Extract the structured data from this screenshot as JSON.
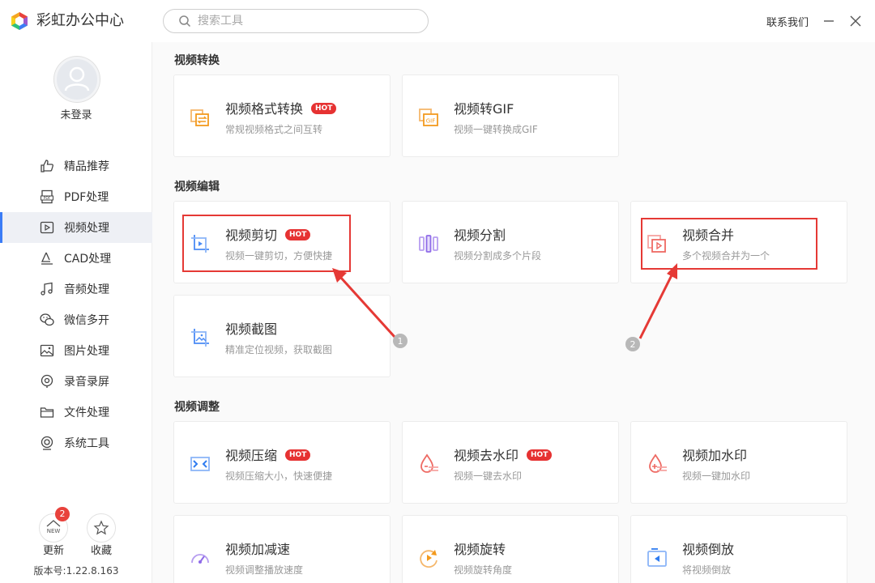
{
  "app": {
    "title": "彩虹办公中心"
  },
  "search": {
    "placeholder": "搜索工具"
  },
  "header": {
    "contact_label": "联系我们"
  },
  "user": {
    "login_status": "未登录"
  },
  "sidebar": {
    "items": [
      {
        "label": "精品推荐",
        "icon": "thumbs-up-icon"
      },
      {
        "label": "PDF处理",
        "icon": "pdf-icon"
      },
      {
        "label": "视频处理",
        "icon": "video-icon",
        "active": true
      },
      {
        "label": "CAD处理",
        "icon": "cad-icon"
      },
      {
        "label": "音频处理",
        "icon": "music-icon"
      },
      {
        "label": "微信多开",
        "icon": "wechat-icon"
      },
      {
        "label": "图片处理",
        "icon": "image-icon"
      },
      {
        "label": "录音录屏",
        "icon": "record-icon"
      },
      {
        "label": "文件处理",
        "icon": "folder-icon"
      },
      {
        "label": "系统工具",
        "icon": "system-tools-icon"
      }
    ],
    "update": {
      "label": "更新",
      "badge": "2",
      "icon_text": "NEW"
    },
    "favorite": {
      "label": "收藏"
    },
    "version": "版本号:1.22.8.163"
  },
  "sections": {
    "convert": {
      "title": "视频转换",
      "cards": [
        {
          "title": "视频格式转换",
          "desc": "常规视频格式之间互转",
          "hot": true,
          "icon": "format-convert-icon"
        },
        {
          "title": "视频转GIF",
          "desc": "视频一键转换成GIF",
          "hot": false,
          "icon": "gif-icon"
        }
      ]
    },
    "edit": {
      "title": "视频编辑",
      "cards": [
        {
          "title": "视频剪切",
          "desc": "视频一键剪切，方便快捷",
          "hot": true,
          "icon": "crop-video-icon"
        },
        {
          "title": "视频分割",
          "desc": "视频分割成多个片段",
          "hot": false,
          "icon": "split-icon"
        },
        {
          "title": "视频合并",
          "desc": "多个视频合并为一个",
          "hot": false,
          "icon": "merge-icon"
        },
        {
          "title": "视频截图",
          "desc": "精准定位视频，获取截图",
          "hot": false,
          "icon": "screenshot-icon"
        }
      ]
    },
    "adjust": {
      "title": "视频调整",
      "cards": [
        {
          "title": "视频压缩",
          "desc": "视频压缩大小，快速便捷",
          "hot": true,
          "icon": "compress-icon"
        },
        {
          "title": "视频去水印",
          "desc": "视频一键去水印",
          "hot": true,
          "icon": "remove-watermark-icon"
        },
        {
          "title": "视频加水印",
          "desc": "视频一键加水印",
          "hot": false,
          "icon": "add-watermark-icon"
        },
        {
          "title": "视频加减速",
          "desc": "视频调整播放速度",
          "hot": false,
          "icon": "speed-icon"
        },
        {
          "title": "视频旋转",
          "desc": "视频旋转角度",
          "hot": false,
          "icon": "rotate-icon"
        },
        {
          "title": "视频倒放",
          "desc": "将视频倒放",
          "hot": false,
          "icon": "reverse-icon"
        }
      ]
    }
  },
  "hot_label": "HOT",
  "annotations": {
    "first": "1",
    "second": "2"
  },
  "colors": {
    "accent": "#3b7cf6",
    "hot": "#e63232",
    "annotation": "#e53935",
    "icon_orange": "#f39a1e"
  }
}
